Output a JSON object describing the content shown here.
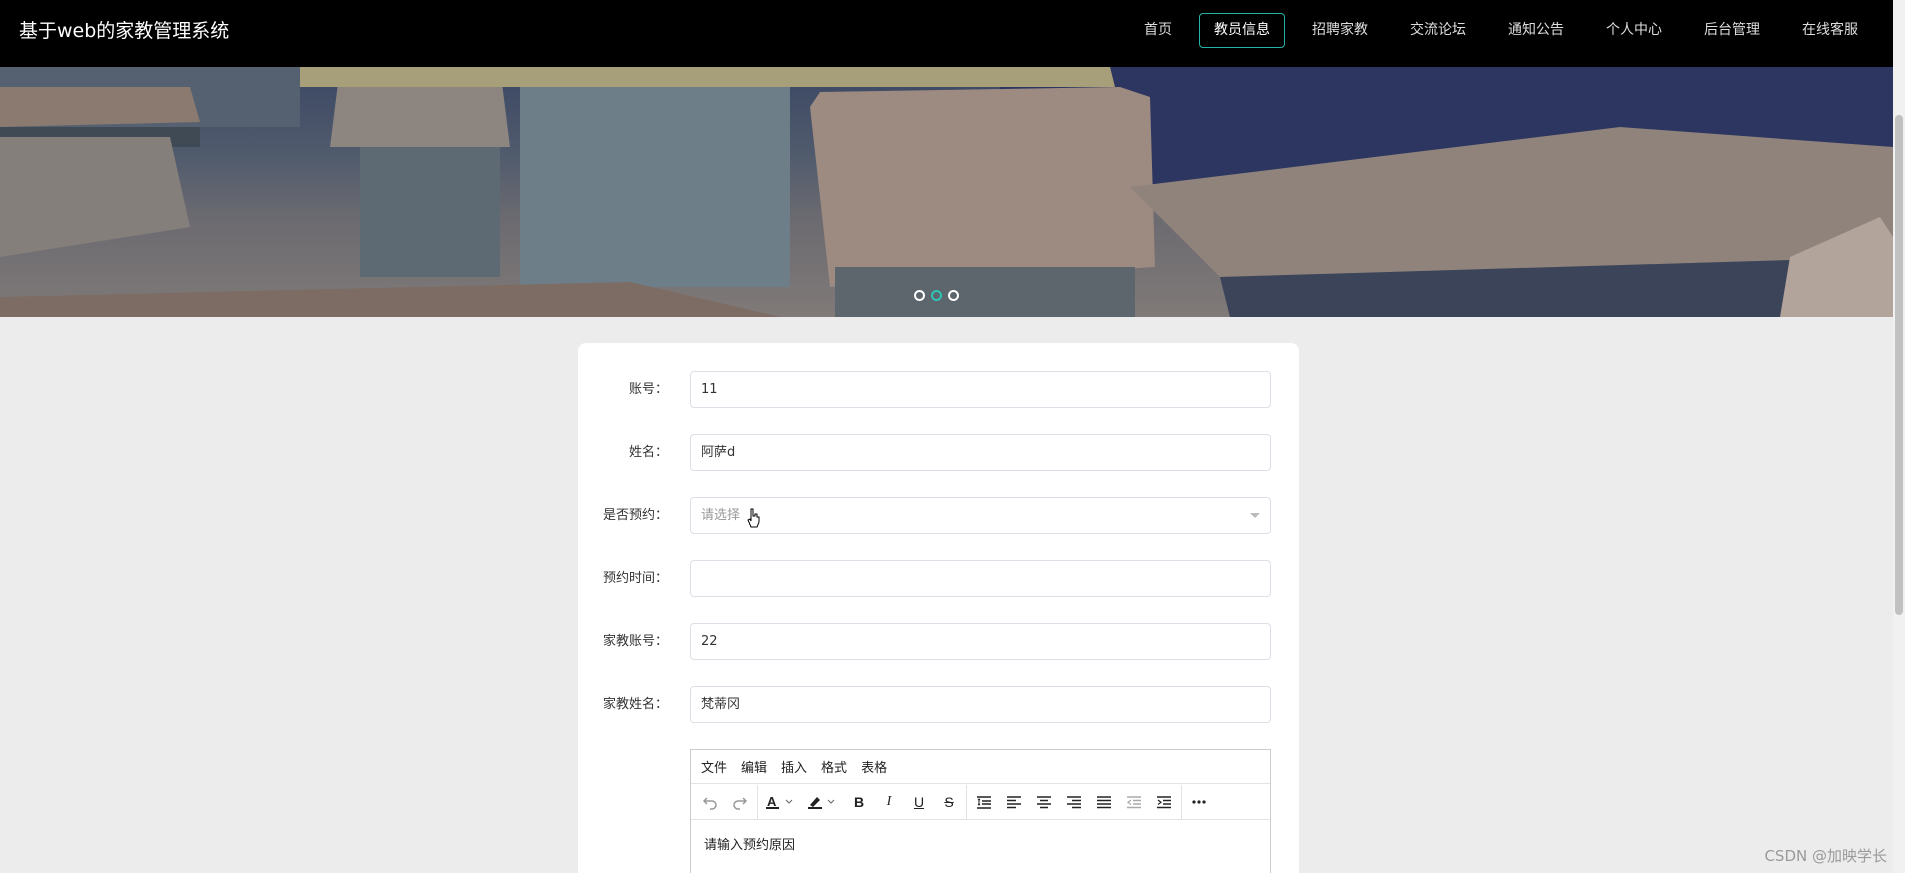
{
  "header": {
    "brand": "基于web的家教管理系统",
    "nav": [
      "首页",
      "教员信息",
      "招聘家教",
      "交流论坛",
      "通知公告",
      "个人中心",
      "后台管理",
      "在线客服"
    ],
    "active_index": 1
  },
  "banner": {
    "dots": 3,
    "active_dot": 1
  },
  "form": {
    "account": {
      "label": "账号：",
      "value": "11"
    },
    "name": {
      "label": "姓名：",
      "value": "阿萨d"
    },
    "reserved": {
      "label": "是否预约：",
      "placeholder": "请选择"
    },
    "reserve_time": {
      "label": "预约时间：",
      "value": ""
    },
    "tutor_account": {
      "label": "家教账号：",
      "value": "22"
    },
    "tutor_name": {
      "label": "家教姓名：",
      "value": "梵蒂冈"
    }
  },
  "editor": {
    "menus": [
      "文件",
      "编辑",
      "插入",
      "格式",
      "表格"
    ],
    "content": "请输入预约原因"
  },
  "watermark": "CSDN @加映学长",
  "colors": {
    "accent": "#26b3a6",
    "header_bg": "#000000",
    "page_bg": "#ececec"
  }
}
